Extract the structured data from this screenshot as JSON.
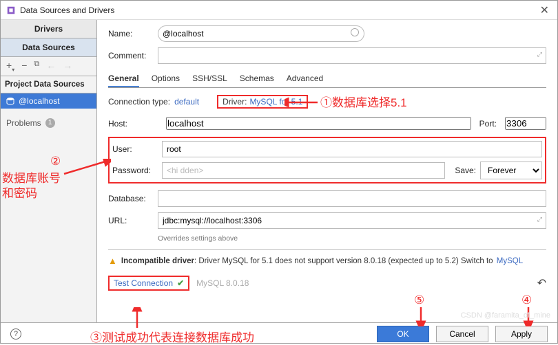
{
  "window": {
    "title": "Data Sources and Drivers"
  },
  "sidebar": {
    "tab_drivers": "Drivers",
    "tab_data_sources": "Data Sources",
    "section_title": "Project Data Sources",
    "tree_item": "@localhost",
    "problems_label": "Problems",
    "problems_count": "1"
  },
  "form": {
    "name_label": "Name:",
    "name_value": "@localhost",
    "comment_label": "Comment:",
    "connection_type_label": "Connection type:",
    "connection_type_value": "default",
    "driver_label": "Driver:",
    "driver_value": "MySQL for 5.1",
    "host_label": "Host:",
    "host_value": "localhost",
    "port_label": "Port:",
    "port_value": "3306",
    "user_label": "User:",
    "user_value": "root",
    "password_label": "Password:",
    "password_placeholder": "<hi dden>",
    "save_label": "Save:",
    "save_value": "Forever",
    "database_label": "Database:",
    "database_value": "",
    "url_label": "URL:",
    "url_value": "jdbc:mysql://localhost:3306",
    "url_note": "Overrides settings above"
  },
  "tabs": [
    "General",
    "Options",
    "SSH/SSL",
    "Schemas",
    "Advanced"
  ],
  "warning": {
    "bold": "Incompatible driver",
    "text": ": Driver MySQL for 5.1 does not support version 8.0.18 (expected up to 5.2) Switch to",
    "link": "MySQL"
  },
  "test": {
    "label": "Test Connection",
    "version": "MySQL 8.0.18"
  },
  "buttons": {
    "ok": "OK",
    "cancel": "Cancel",
    "apply": "Apply"
  },
  "annotations": {
    "a1": "①数据库选择5.1",
    "a2_num": "②",
    "a2_l1": "数据库账号",
    "a2_l2": "和密码",
    "a3": "③测试成功代表连接数据库成功",
    "a4": "④",
    "a5": "⑤"
  },
  "watermark": "CSDN @faramita_of_mine"
}
